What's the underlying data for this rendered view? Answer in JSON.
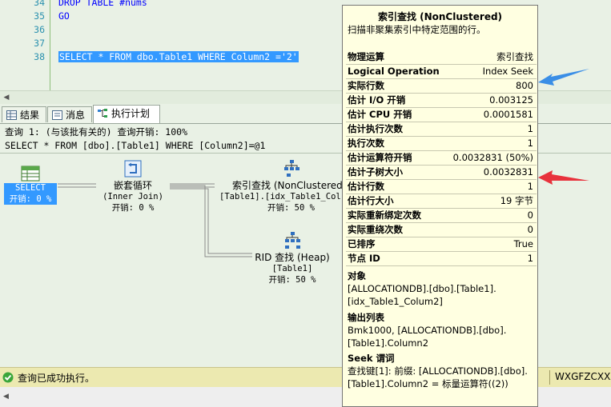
{
  "editor": {
    "lines": [
      {
        "num": "34",
        "code": "DROP TABLE #nums"
      },
      {
        "num": "35",
        "code": "GO"
      },
      {
        "num": "36",
        "code": ""
      },
      {
        "num": "37",
        "code": ""
      },
      {
        "num": "38",
        "code": "SELECT * FROM dbo.Table1 WHERE Column2 ='2'"
      }
    ]
  },
  "tabs": [
    {
      "label": "结果",
      "icon": "grid-icon"
    },
    {
      "label": "消息",
      "icon": "message-icon"
    },
    {
      "label": "执行计划",
      "icon": "execution-plan-icon"
    }
  ],
  "plan": {
    "query_header": "查询 1: (与该批有关的) 查询开销: 100%",
    "query_text": "SELECT * FROM [dbo].[Table1] WHERE [Column2]=@1",
    "operators": {
      "select": {
        "name": "SELECT",
        "cost": "开销: 0 %"
      },
      "nested_loops": {
        "name": "嵌套循环",
        "sub": "(Inner Join)",
        "cost": "开销: 0 %"
      },
      "index_seek": {
        "name": "索引查找 (NonClustered)",
        "sub": "[Table1].[idx_Table1_Col",
        "cost": "开销: 50 %"
      },
      "rid_lookup": {
        "name": "RID 查找 (Heap)",
        "sub": "[Table1]",
        "cost": "开销: 50 %"
      }
    }
  },
  "tooltip": {
    "title": "索引查找 (NonClustered)",
    "description": "扫描非聚集索引中特定范围的行。",
    "properties": [
      {
        "name": "物理运算",
        "value": "索引查找"
      },
      {
        "name": "Logical Operation",
        "value": "Index Seek"
      },
      {
        "name": "实际行数",
        "value": "800"
      },
      {
        "name": "估计 I/O 开销",
        "value": "0.003125"
      },
      {
        "name": "估计 CPU 开销",
        "value": "0.0001581"
      },
      {
        "name": "估计执行次数",
        "value": "1"
      },
      {
        "name": "执行次数",
        "value": "1"
      },
      {
        "name": "估计运算符开销",
        "value": "0.0032831 (50%)"
      },
      {
        "name": "估计子树大小",
        "value": "0.0032831"
      },
      {
        "name": "估计行数",
        "value": "1"
      },
      {
        "name": "估计行大小",
        "value": "19 字节"
      },
      {
        "name": "实际重新绑定次数",
        "value": "0"
      },
      {
        "name": "实际重绕次数",
        "value": "0"
      },
      {
        "name": "已排序",
        "value": "True"
      },
      {
        "name": "节点 ID",
        "value": "1"
      }
    ],
    "object_label": "对象",
    "object_value": "[ALLOCATIONDB].[dbo].[Table1].[idx_Table1_Colum2]",
    "output_label": "输出列表",
    "output_value": "Bmk1000, [ALLOCATIONDB].[dbo].[Table1].Column2",
    "seek_label": "Seek 谓词",
    "seek_value": "查找键[1]: 前缀: [ALLOCATIONDB].[dbo].[Table1].Column2 = 标量运算符((2))"
  },
  "status": {
    "message": "查询已成功执行。",
    "server": "WXGFZCXXZ"
  },
  "colors": {
    "annotation_blue": "#3a8ee6",
    "annotation_red": "#e8323c",
    "selection": "#3399ff"
  }
}
